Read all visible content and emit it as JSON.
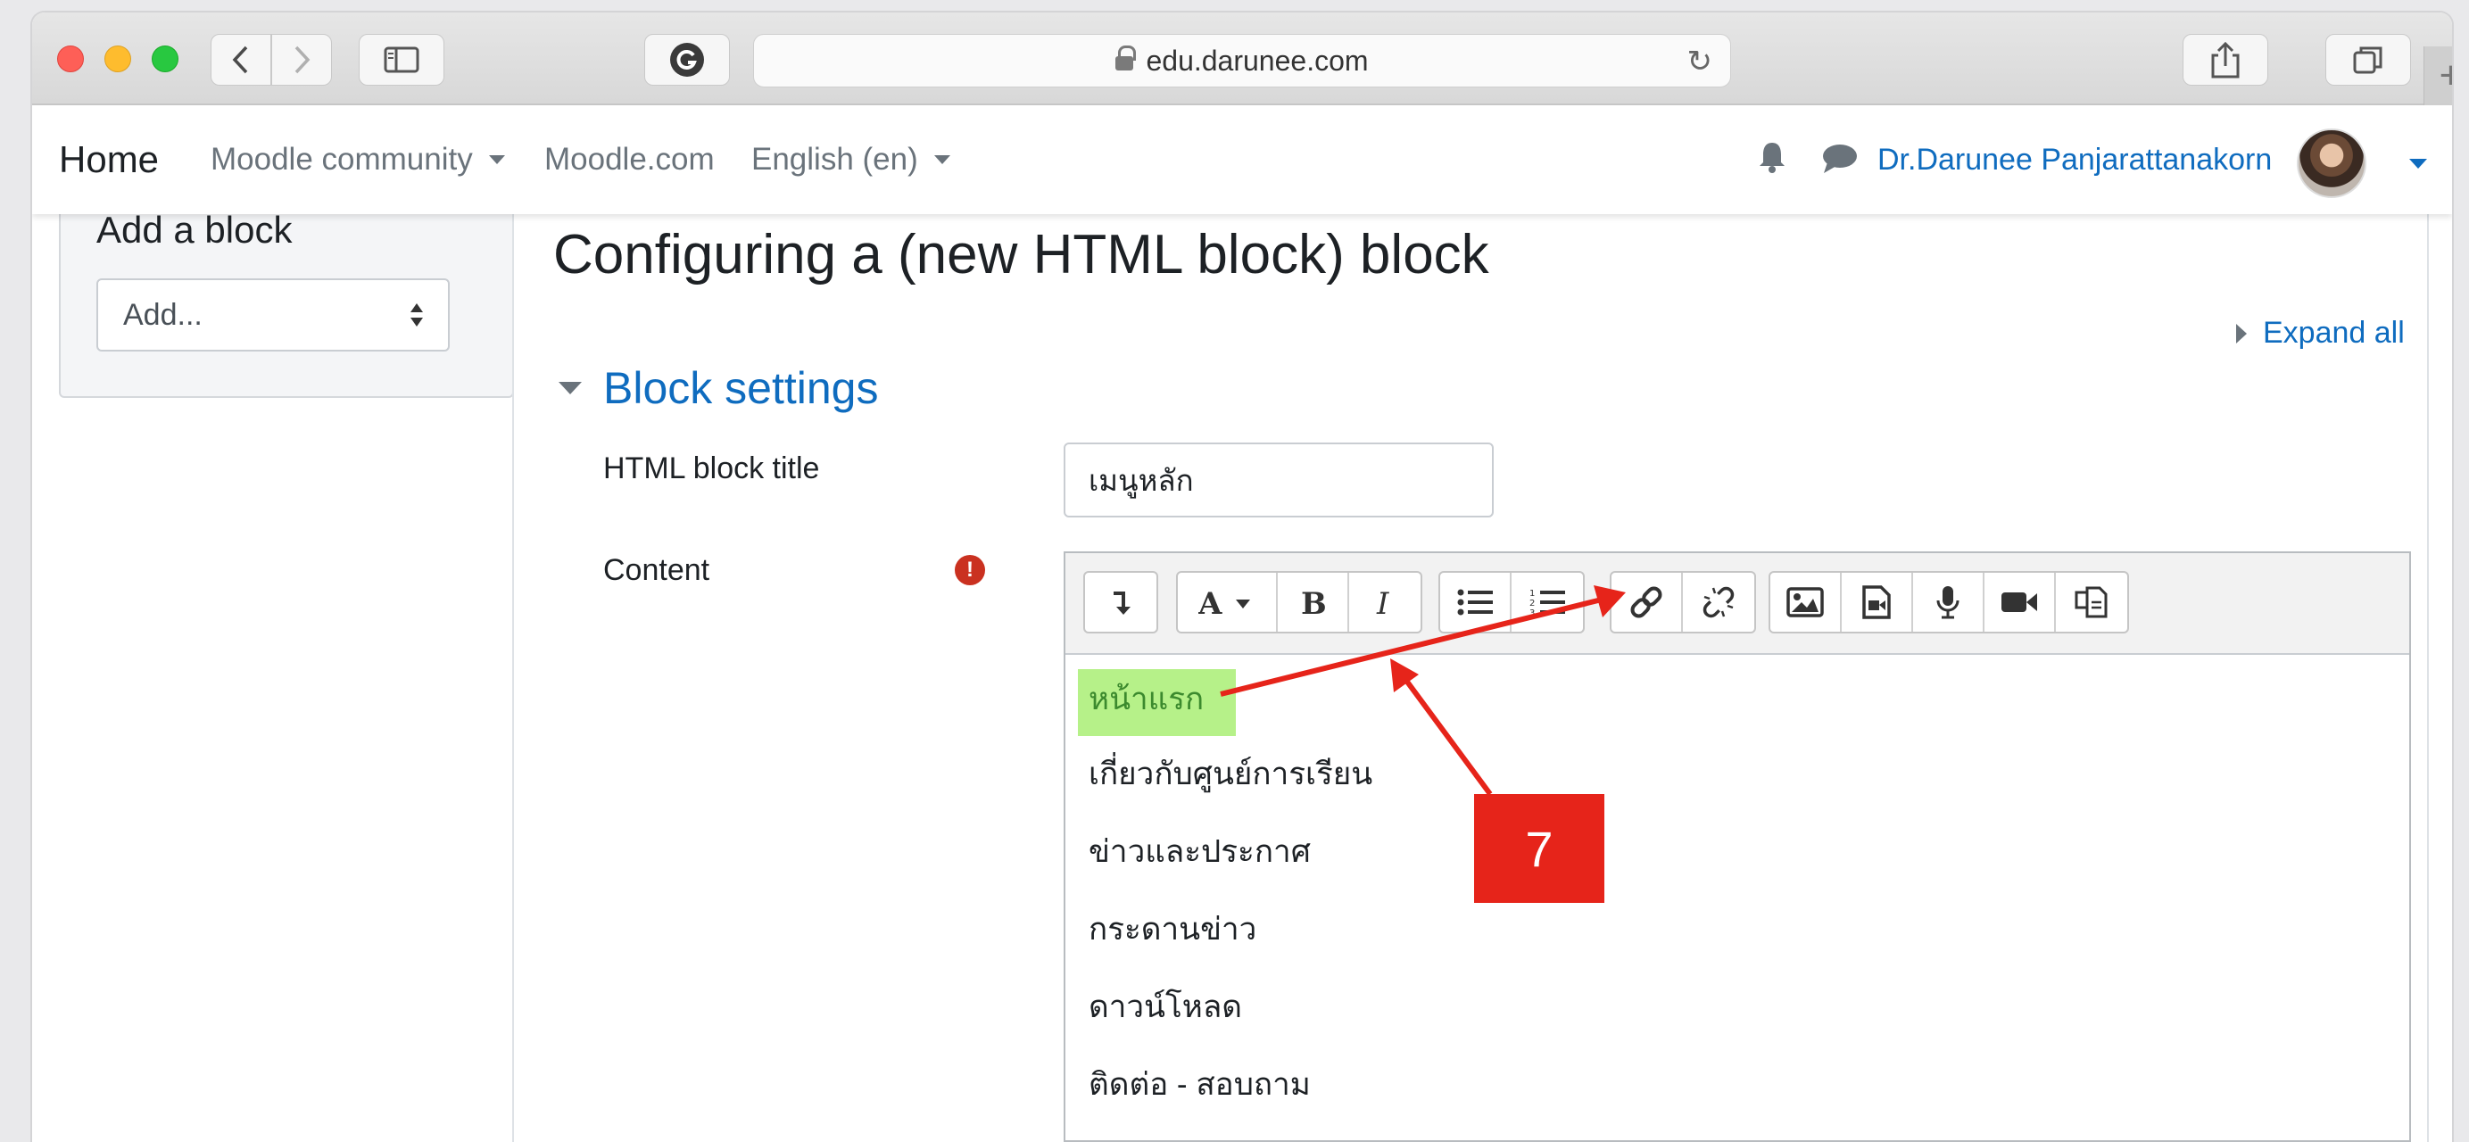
{
  "browser": {
    "url": "edu.darunee.com",
    "back_icon": "chevron-left-icon",
    "forward_icon": "chevron-right-icon",
    "new_tab_label": "+"
  },
  "navbar": {
    "home": "Home",
    "community": "Moodle community",
    "moodlecom": "Moodle.com",
    "language": "English (en)",
    "user_name": "Dr.Darunee Panjarattanakorn"
  },
  "sidebar": {
    "block_title": "Add a block",
    "select_value": "Add..."
  },
  "main": {
    "page_title": "Configuring a (new HTML block) block",
    "expand_all": "Expand all",
    "section_title": "Block settings",
    "title_label": "HTML block title",
    "title_value": "เมนูหลัก",
    "content_label": "Content",
    "required_mark": "!"
  },
  "editor": {
    "lines": [
      "หน้าแรก",
      "เกี่ยวกับศูนย์การเรียน",
      "ข่าวและประกาศ",
      "กระดานข่าว",
      "ดาวน์โหลด",
      "ติดต่อ - สอบถาม"
    ]
  },
  "annotation": {
    "step_number": "7",
    "color": "#e6241a"
  },
  "colors": {
    "link": "#0f6cbf",
    "highlight": "#b6f189"
  }
}
